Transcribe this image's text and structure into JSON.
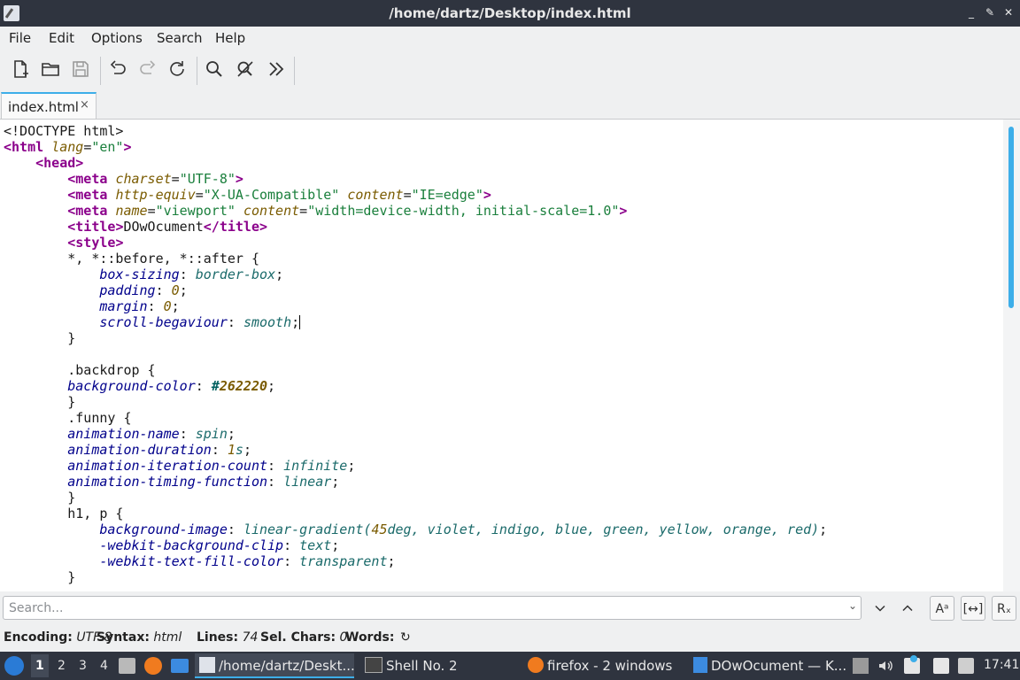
{
  "window": {
    "title": "/home/dartz/Desktop/index.html",
    "controls": [
      "minimize",
      "maximize",
      "close"
    ]
  },
  "menu": [
    "File",
    "Edit",
    "Options",
    "Search",
    "Help"
  ],
  "toolbar": {
    "icons": [
      "new-file-icon",
      "open-folder-icon",
      "save-icon",
      "undo-icon",
      "redo-icon",
      "reload-icon",
      "search-icon",
      "find-replace-icon",
      "more-icon"
    ]
  },
  "tab": {
    "label": "index.html",
    "close": "×"
  },
  "editor": {
    "lines": [
      "<!DOCTYPE html>",
      "<html lang=\"en\">",
      "    <head>",
      "        <meta charset=\"UTF-8\">",
      "        <meta http-equiv=\"X-UA-Compatible\" content=\"IE=edge\">",
      "        <meta name=\"viewport\" content=\"width=device-width, initial-scale=1.0\">",
      "        <title>DOwOcument</title>",
      "        <style>",
      "        *, *::before, *::after {",
      "            box-sizing: border-box;",
      "            padding: 0;",
      "            margin: 0;",
      "            scroll-begaviour: smooth;",
      "        }",
      "",
      "        .backdrop {",
      "        background-color: #262220;",
      "        }",
      "        .funny {",
      "        animation-name: spin;",
      "        animation-duration: 1s;",
      "        animation-iteration-count: infinite;",
      "        animation-timing-function: linear;",
      "        }",
      "        h1, p {",
      "            background-image: linear-gradient(45deg, violet, indigo, blue, green, yellow, orange, red);",
      "            -webkit-background-clip: text;",
      "            -webkit-text-fill-color: transparent;",
      "        }"
    ]
  },
  "search": {
    "placeholder": "Search...",
    "value": ""
  },
  "status": {
    "encoding_label": "Encoding:",
    "encoding": "UTF-8",
    "syntax_label": "Syntax:",
    "syntax": "html",
    "lines_label": "Lines:",
    "lines": "74",
    "selchars_label": "Sel. Chars:",
    "selchars": "0",
    "words_label": "Words:"
  },
  "taskbar": {
    "workspaces": [
      "1",
      "2",
      "3",
      "4"
    ],
    "tasks": [
      {
        "label": "/home/dartz/Deskt...",
        "active": true
      },
      {
        "label": "Shell No. 2",
        "active": false
      },
      {
        "label": "firefox - 2 windows",
        "active": false
      },
      {
        "label": "DOwOcument — K...",
        "active": false
      }
    ],
    "clock": "17:41"
  },
  "colors": {
    "accent": "#3daee9",
    "titlebar": "#2f343f",
    "tag": "#8b008b",
    "string": "#1a7f3c",
    "property": "#00008b"
  }
}
